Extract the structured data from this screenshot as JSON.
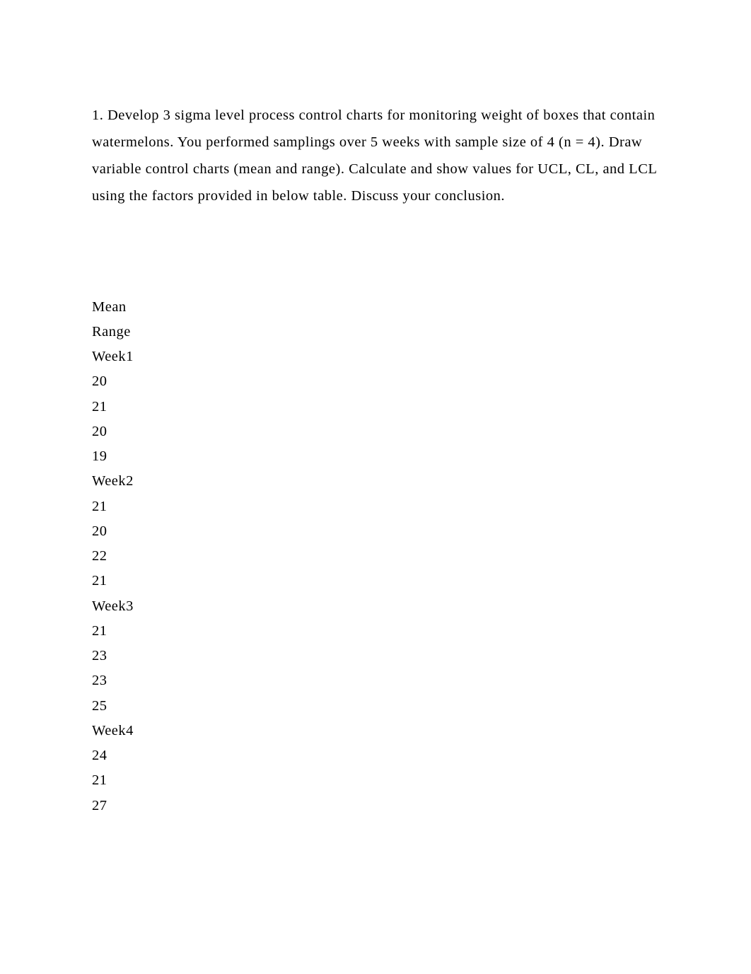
{
  "question": {
    "text": "1. Develop 3 sigma level process control charts for monitoring weight of boxes that contain watermelons. You performed samplings over 5 weeks with sample size of 4 (n = 4). Draw variable control charts (mean and range). Calculate and show values for UCL, CL, and LCL using the factors provided in below table. Discuss your conclusion."
  },
  "data": {
    "header1": "Mean",
    "header2": "Range",
    "weeks": [
      {
        "label": "Week1",
        "values": [
          "20",
          "21",
          "20",
          "19"
        ]
      },
      {
        "label": "Week2",
        "values": [
          "21",
          "20",
          "22",
          "21"
        ]
      },
      {
        "label": "Week3",
        "values": [
          "21",
          "23",
          "23",
          "25"
        ]
      },
      {
        "label": "Week4",
        "values": [
          "24",
          "21",
          "27"
        ]
      }
    ]
  }
}
